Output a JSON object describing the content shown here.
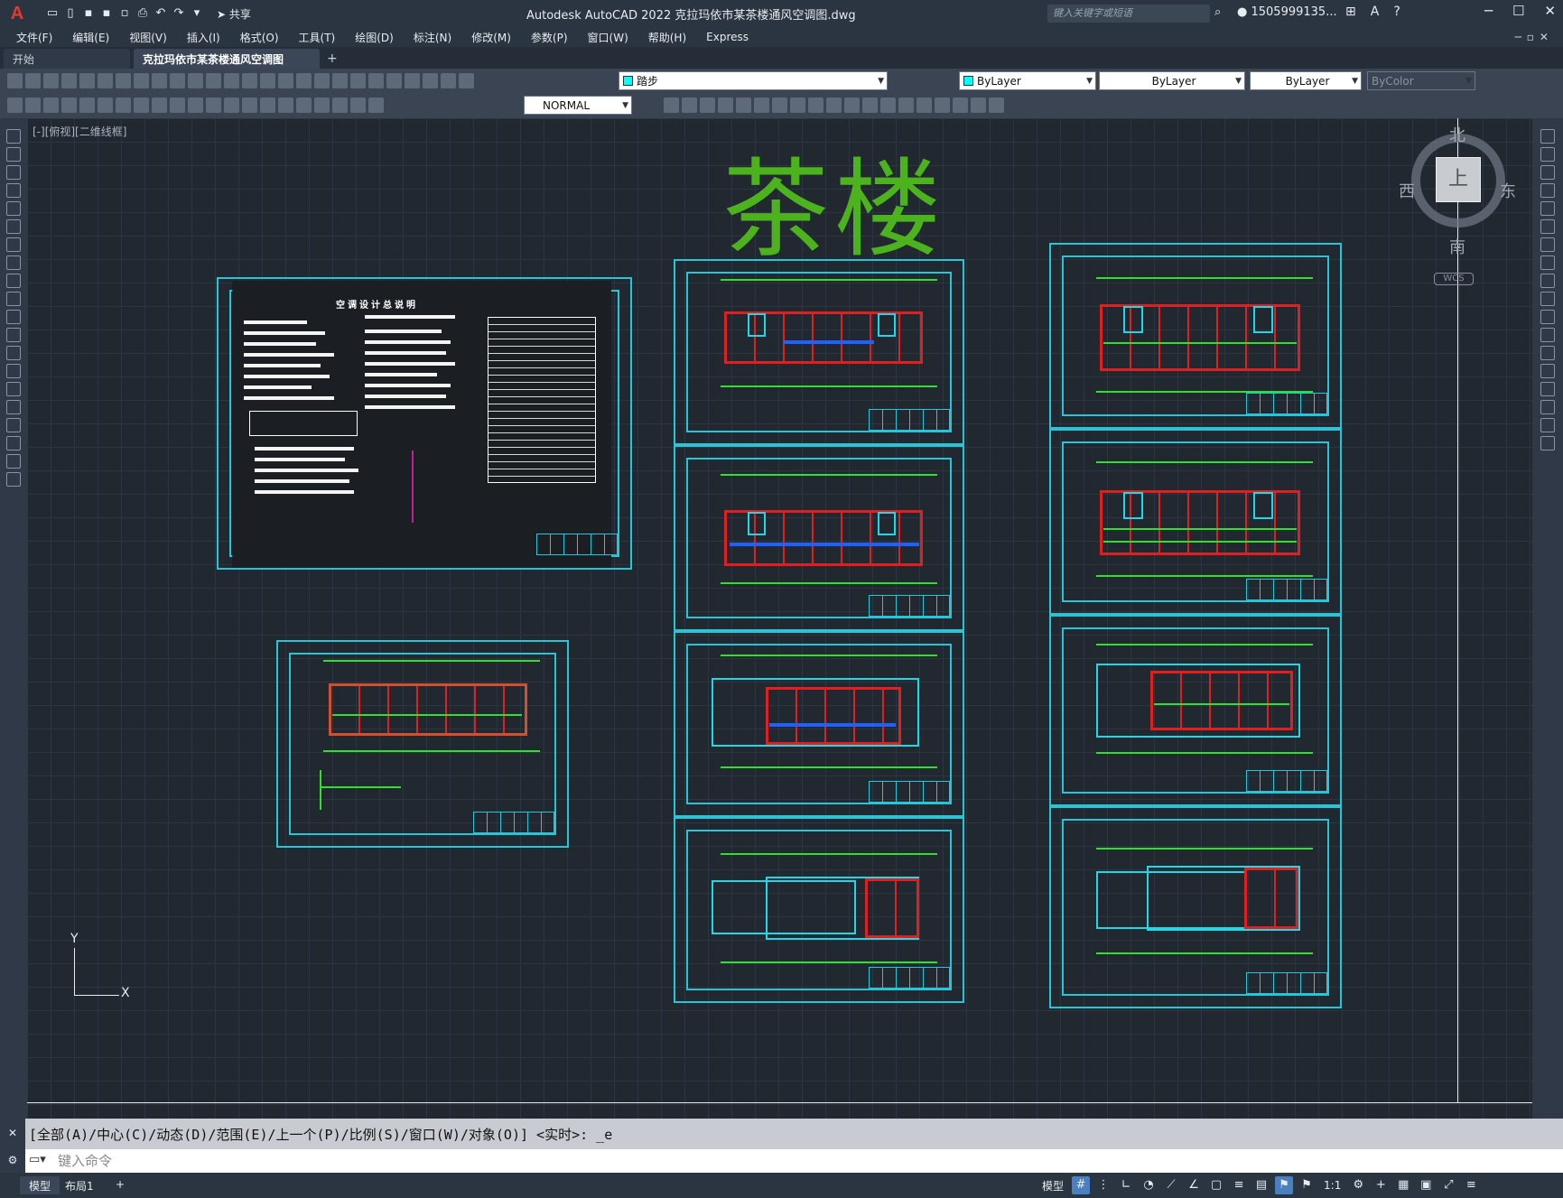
{
  "app": {
    "logo_letter": "A",
    "window_title": "Autodesk AutoCAD 2022    克拉玛依市某茶楼通风空调图.dwg",
    "share_label": "共享",
    "search_placeholder": "键入关键字或短语",
    "user_name": "1505999135...",
    "window_controls": [
      "─",
      "☐",
      "✕"
    ]
  },
  "menu": {
    "items": [
      "文件(F)",
      "编辑(E)",
      "视图(V)",
      "插入(I)",
      "格式(O)",
      "工具(T)",
      "绘图(D)",
      "标注(N)",
      "修改(M)",
      "参数(P)",
      "窗口(W)",
      "帮助(H)",
      "Express"
    ]
  },
  "tabs": {
    "items": [
      {
        "label": "开始"
      },
      {
        "label": "克拉玛依市某茶楼通风空调图*"
      }
    ],
    "close_symbol": "✕",
    "add_symbol": "+"
  },
  "properties": {
    "layer": "踏步",
    "color": "ByLayer",
    "linetype": "ByLayer",
    "lineweight": "ByLayer",
    "plotstyle": "ByColor",
    "dimstyle": "NORMAL"
  },
  "viewport": {
    "label": "[-][俯视][二维线框]",
    "drawing_title": "茶楼"
  },
  "viewcube": {
    "face": "上",
    "north": "北",
    "south": "南",
    "east": "东",
    "west": "西",
    "wcs": "WCS"
  },
  "ucs": {
    "x": "X",
    "y": "Y"
  },
  "command": {
    "history": "[全部(A)/中心(C)/动态(D)/范围(E)/上一个(P)/比例(S)/窗口(W)/对象(O)] <实时>: _e",
    "placeholder": "键入命令"
  },
  "status": {
    "tab_model": "模型",
    "tab_layout": "布局1",
    "tab_add": "+",
    "model_label": "模型",
    "scale": "1:1"
  },
  "sheets": {
    "notes_title": "空调设计总说明"
  }
}
